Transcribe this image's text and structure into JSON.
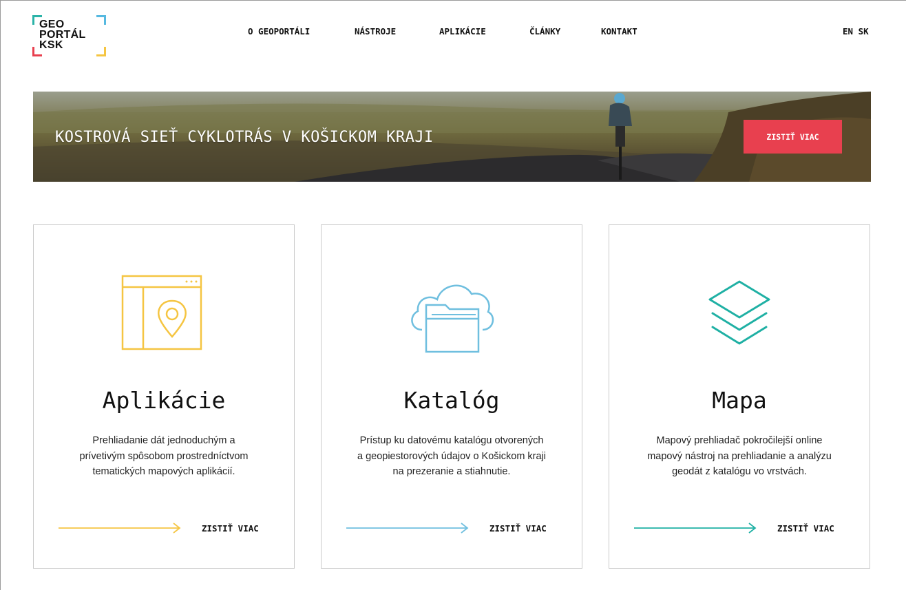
{
  "logo": {
    "line1": "GEO",
    "line2": "PORTÁL",
    "line3": "KSK"
  },
  "nav": {
    "items": [
      "O GEOPORTÁLI",
      "NÁSTROJE",
      "APLIKÁCIE",
      "ČLÁNKY",
      "KONTAKT"
    ],
    "lang_en": "EN",
    "lang_sk": "SK"
  },
  "banner": {
    "title": "KOSTROVÁ SIEŤ CYKLOTRÁS V KOŠICKOM KRAJI",
    "button": "ZISTIŤ VIAC",
    "button_color": "#e8404f"
  },
  "cards": [
    {
      "icon": "app-map-pin-icon",
      "color": "#f5c542",
      "title": "Aplikácie",
      "desc": [
        "Prehliadanie dát jednoduchým a",
        "prívetivým spôsobom prostredníctvom",
        "tematických mapových aplikácií."
      ],
      "more": "ZISTIŤ VIAC"
    },
    {
      "icon": "cloud-folder-icon",
      "color": "#6fbfdf",
      "title": "Katalóg",
      "desc": [
        "Prístup ku datovému katalógu otvorených",
        "a geopiestorových údajov o Košickom kraji",
        "na prezeranie a stiahnutie."
      ],
      "more": "ZISTIŤ VIAC"
    },
    {
      "icon": "layers-icon",
      "color": "#1fb0a4",
      "title": "Mapa",
      "desc": [
        "Mapový prehliadač pokročilejší online",
        "mapový nástroj na prehliadanie a analýzu",
        "geodát z katalógu vo vrstvách."
      ],
      "more": "ZISTIŤ VIAC"
    }
  ]
}
